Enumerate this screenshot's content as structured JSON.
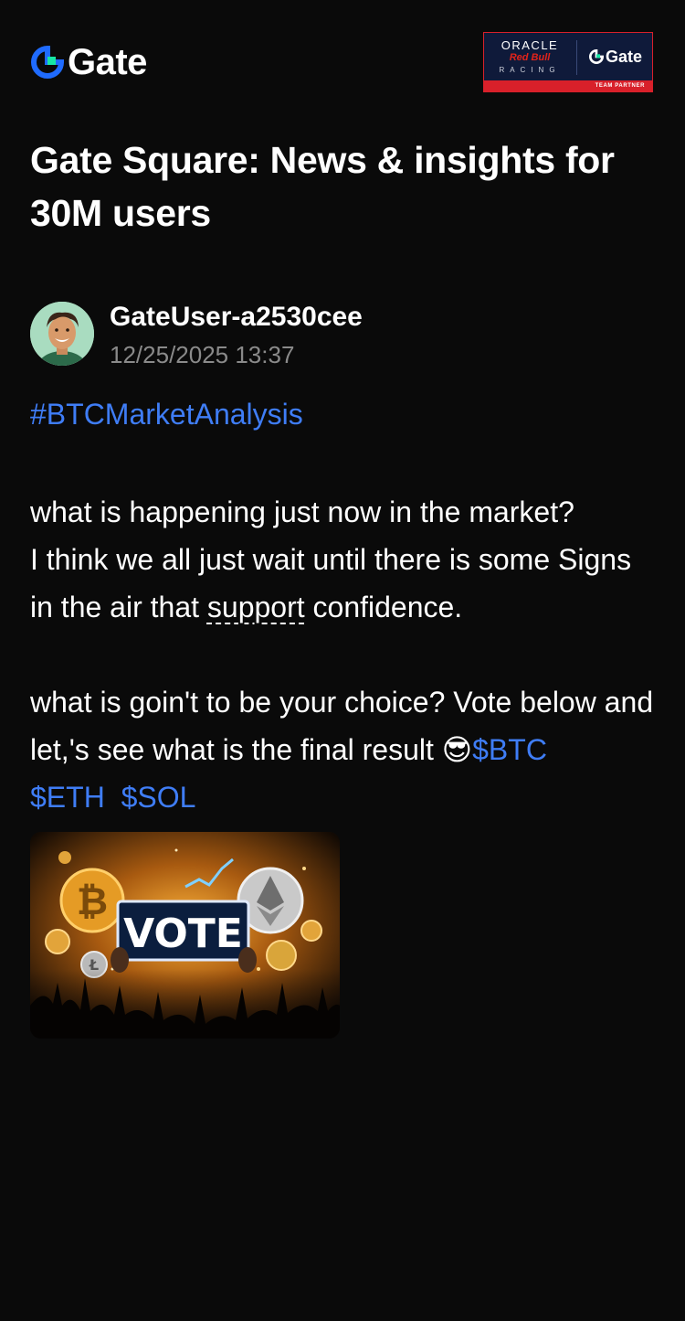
{
  "brand": {
    "logo_text": "Gate",
    "partner_badge": {
      "line1": "ORACLE",
      "line2": "Red Bull",
      "line3": "RACING",
      "partner_name": "Gate",
      "strip_text": "TEAM PARTNER"
    }
  },
  "page": {
    "title": "Gate Square: News & insights for 30M users"
  },
  "post": {
    "author": "GateUser-a2530cee",
    "timestamp": "12/25/2025 13:37",
    "hashtag": "#BTCMarketAnalysis",
    "paragraph1_line1": "what is happening just now in the market?",
    "paragraph1_line2_before": "I think we all just wait until there is some Signs in the air that ",
    "paragraph1_link": "support",
    "paragraph1_line2_after": " confidence.",
    "paragraph2_text": "what is goin't to be your choice? Vote below and let,'s see what is the final result ",
    "emoji": "😎",
    "tickers": [
      "$BTC",
      "$ETH",
      "$SOL"
    ],
    "image_sign_text": "VOTE"
  },
  "colors": {
    "background": "#0a0a0a",
    "accent_link": "#3f7df6",
    "muted_text": "#8a8a8a",
    "brand_blue": "#1f6bff",
    "brand_green": "#17e7a6"
  }
}
